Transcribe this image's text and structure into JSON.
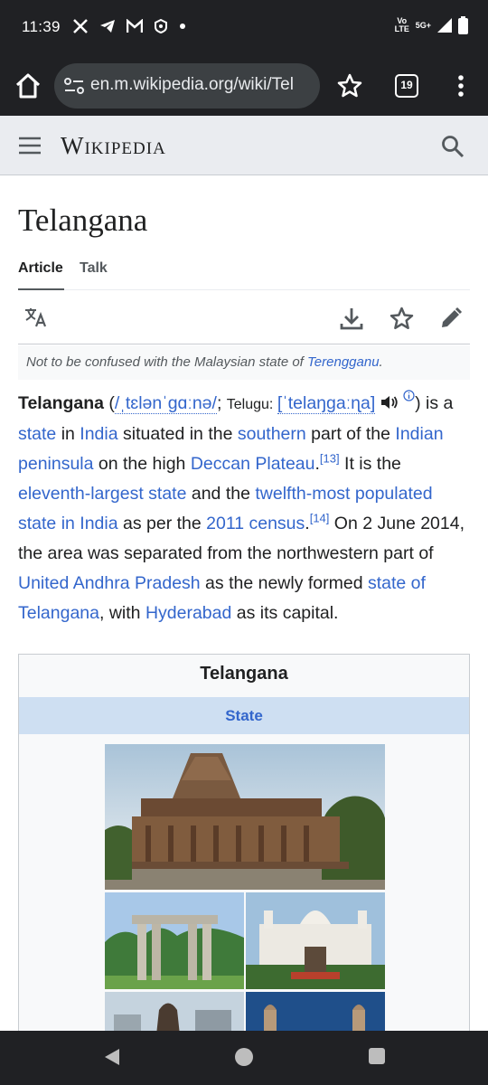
{
  "status": {
    "time": "11:39",
    "network": "5G+",
    "volte": "Vo LTE"
  },
  "browser": {
    "url": "en.m.wikipedia.org/wiki/Tel",
    "tab_count": "19"
  },
  "wiki": {
    "logo": "Wikipedia"
  },
  "article": {
    "title": "Telangana",
    "tabs": [
      {
        "label": "Article"
      },
      {
        "label": "Talk"
      }
    ],
    "hatnote_prefix": "Not to be confused with the Malaysian state of ",
    "hatnote_link": "Terengganu",
    "hatnote_suffix": "."
  },
  "lead": {
    "t1": "Telangana",
    "t2": " (",
    "ipa_en": "/ˌtɛlənˈɡɑːnə/",
    "t3": "; ",
    "telugu_label": "Telugu: ",
    "ipa_te": "[ˈtelaŋɡaːɳa]",
    "t4": ") is a ",
    "l_state": "state",
    "t5": " in ",
    "l_india": "India",
    "t6": " situated in the ",
    "l_southern": "southern",
    "t7": " part of the ",
    "l_peninsula": "Indian peninsula",
    "t8": " on the high ",
    "l_deccan": "Deccan Plateau",
    "t9": ".",
    "ref13": "[13]",
    "t10": " It is the ",
    "l_eleventh": "eleventh-largest state",
    "t11": " and the ",
    "l_twelfth": "twelfth-most populated state in India",
    "t12": " as per the ",
    "l_census": "2011 census",
    "t13": ".",
    "ref14": "[14]",
    "t14": " On 2 June 2014, the area was separated from the northwestern part of ",
    "l_andhra": "United Andhra Pradesh",
    "t15": " as the newly formed ",
    "l_stateof": "state of Telangana",
    "t16": ", with ",
    "l_hyderabad": "Hyderabad",
    "t17": " as its capital."
  },
  "infobox": {
    "title": "Telangana",
    "type": "State"
  }
}
